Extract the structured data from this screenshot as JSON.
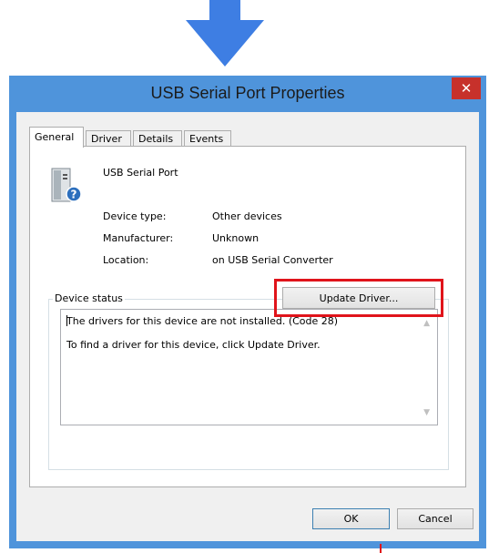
{
  "window": {
    "title": "USB Serial Port Properties",
    "close_glyph": "✕"
  },
  "tabs": [
    {
      "label": "General",
      "active": true
    },
    {
      "label": "Driver",
      "active": false
    },
    {
      "label": "Details",
      "active": false
    },
    {
      "label": "Events",
      "active": false
    }
  ],
  "device": {
    "name": "USB Serial Port",
    "icon": "usb-device-warning-icon",
    "properties": [
      {
        "label": "Device type:",
        "value": "Other devices"
      },
      {
        "label": "Manufacturer:",
        "value": "Unknown"
      },
      {
        "label": "Location:",
        "value": "on USB Serial Converter"
      }
    ]
  },
  "status": {
    "group_label": "Device status",
    "lines": [
      "The drivers for this device are not installed. (Code 28)",
      "To find a driver for this device, click Update Driver."
    ],
    "update_button": "Update Driver..."
  },
  "buttons": {
    "ok": "OK",
    "cancel": "Cancel"
  },
  "colors": {
    "title_bar": "#4f94db",
    "close_button": "#c7312b",
    "highlight": "#e0141b",
    "arrow": "#3e7ee3"
  }
}
